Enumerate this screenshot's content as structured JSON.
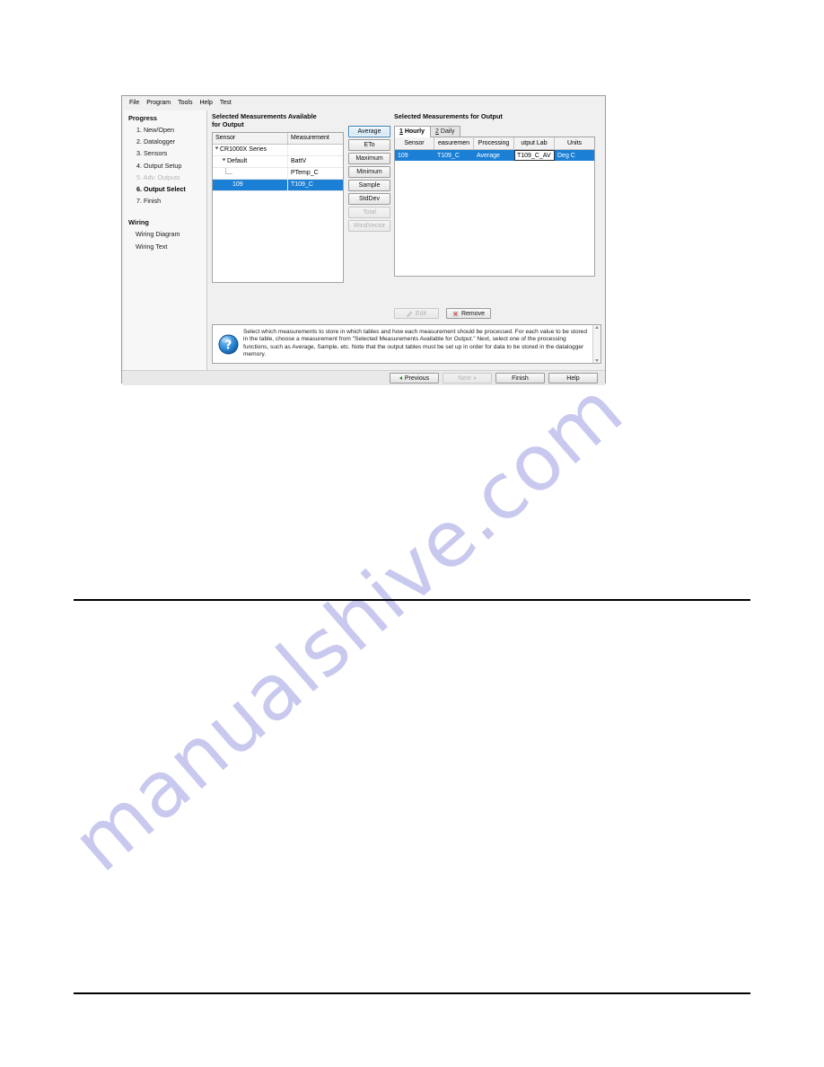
{
  "page": {
    "watermark": "manualshive.com"
  },
  "window": {
    "menu": [
      {
        "label": "File"
      },
      {
        "label": "Program"
      },
      {
        "label": "Tools"
      },
      {
        "label": "Help"
      },
      {
        "label": "Test"
      }
    ]
  },
  "sidebar": {
    "progress_heading": "Progress",
    "steps": [
      {
        "label": "1. New/Open",
        "state": "normal"
      },
      {
        "label": "2. Datalogger",
        "state": "normal"
      },
      {
        "label": "3. Sensors",
        "state": "normal"
      },
      {
        "label": "4. Output Setup",
        "state": "normal"
      },
      {
        "label": "5. Adv. Outputs",
        "state": "disabled"
      },
      {
        "label": "6. Output Select",
        "state": "current"
      },
      {
        "label": "7. Finish",
        "state": "normal"
      }
    ],
    "wiring_heading": "Wiring",
    "wiring_items": [
      {
        "label": "Wiring Diagram"
      },
      {
        "label": "Wiring Text"
      }
    ]
  },
  "available": {
    "title_line1": "Selected Measurements Available",
    "title_line2": "for Output",
    "columns": [
      "Sensor",
      "Measurement"
    ],
    "rows": [
      {
        "sensor": "CR1000X Series",
        "measurement": "",
        "indent": 0,
        "arrow": true,
        "selected": false
      },
      {
        "sensor": "Default",
        "measurement": "BattV",
        "indent": 1,
        "arrow": true,
        "selected": false
      },
      {
        "sensor": "",
        "measurement": "PTemp_C",
        "indent": 2,
        "arrow": false,
        "selected": false
      },
      {
        "sensor": "109",
        "measurement": "T109_C",
        "indent": 2,
        "arrow": false,
        "selected": true
      }
    ]
  },
  "functions": {
    "buttons": [
      {
        "label": "Average",
        "state": "focused"
      },
      {
        "label": "ETo",
        "state": "normal"
      },
      {
        "label": "Maximum",
        "state": "normal"
      },
      {
        "label": "Minimum",
        "state": "normal"
      },
      {
        "label": "Sample",
        "state": "normal"
      },
      {
        "label": "StdDev",
        "state": "normal"
      },
      {
        "label": "Total",
        "state": "disabled"
      },
      {
        "label": "WindVector",
        "state": "disabled"
      }
    ]
  },
  "output": {
    "title": "Selected Measurements for Output",
    "tabs": [
      {
        "accel": "1",
        "label": " Hourly",
        "active": true
      },
      {
        "accel": "2",
        "label": " Daily",
        "active": false
      }
    ],
    "columns": [
      "Sensor",
      "easuremen",
      "Processing",
      "utput Lab",
      "Units"
    ],
    "rows": [
      {
        "sensor": "109",
        "measurement": "T109_C",
        "processing": "Average",
        "output_label": "T109_C_AV",
        "units": "Deg C",
        "selected": true,
        "label_editing": true
      }
    ],
    "tools": [
      {
        "label": "Edit",
        "icon": "pencil-icon",
        "state": "disabled"
      },
      {
        "label": "Remove",
        "icon": "remove-x-icon",
        "state": "normal"
      }
    ]
  },
  "hint": {
    "icon": "question-mark-icon",
    "text": "Select which measurements to store in which tables and how each measurement should be processed. For each value to be stored in the table, choose a measurement from \"Selected Measurements Available for Output.\"  Next, select one of the processing functions, such as Average, Sample, etc. Note that the output tables must be set up in order for data to be stored in the datalogger memory."
  },
  "footer": {
    "buttons": [
      {
        "label": "Previous",
        "icon": "arrow-left-icon",
        "state": "normal"
      },
      {
        "label": "Next",
        "icon": "arrow-right-icon",
        "state": "disabled"
      },
      {
        "label": "Finish",
        "icon": "",
        "state": "normal"
      },
      {
        "label": "Help",
        "icon": "",
        "state": "normal"
      }
    ]
  },
  "colors": {
    "selection_blue": "#1c7fd6",
    "window_gray": "#f0f0f0",
    "watermark": "#c9c9ef"
  }
}
